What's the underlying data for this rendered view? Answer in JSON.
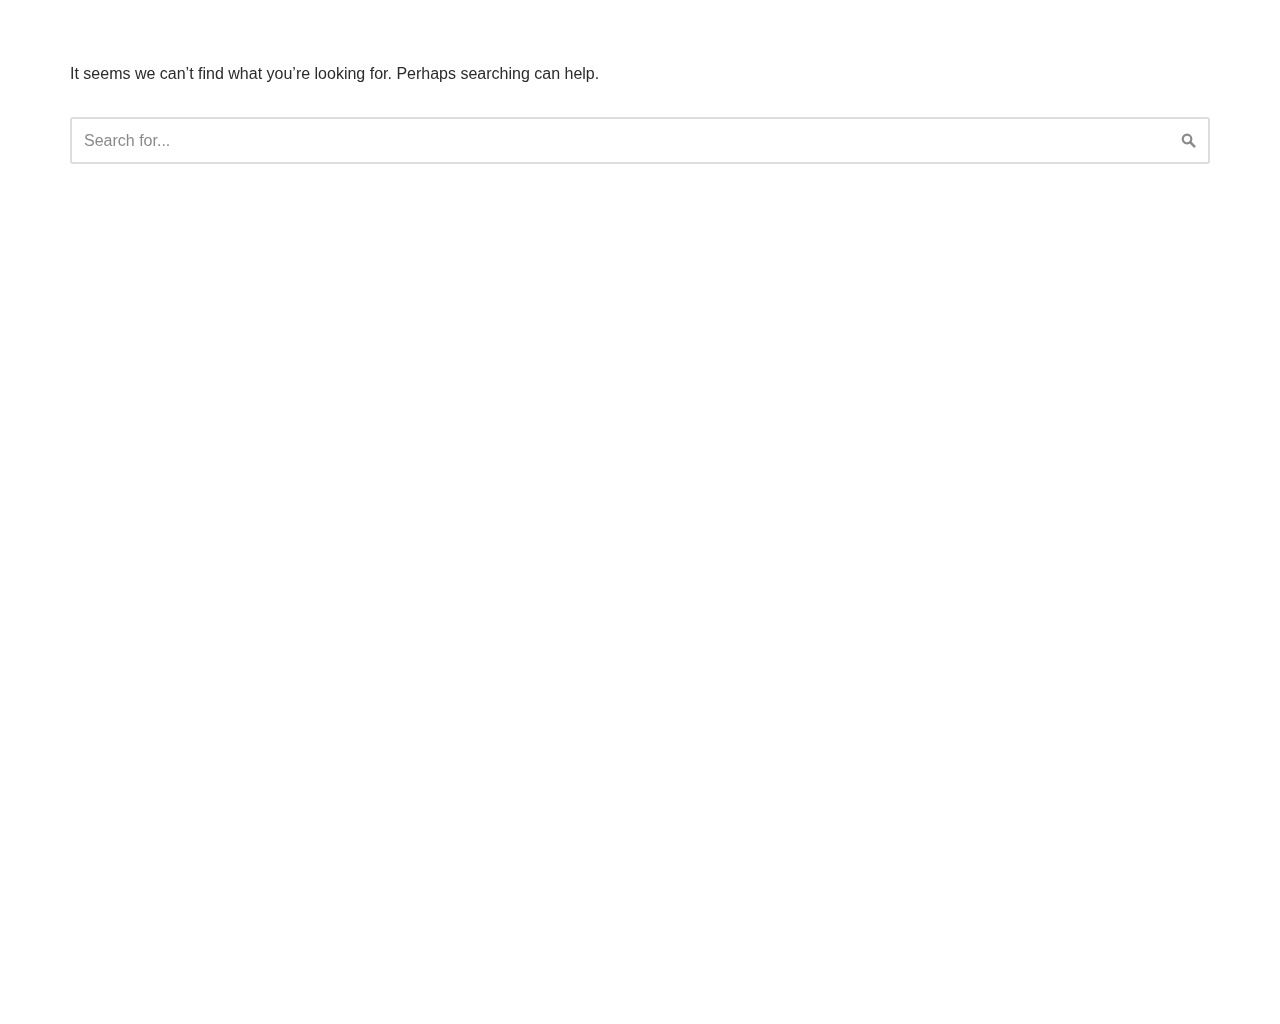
{
  "message": "It seems we can’t find what you’re looking for. Perhaps searching can help.",
  "search": {
    "placeholder": "Search for..."
  }
}
